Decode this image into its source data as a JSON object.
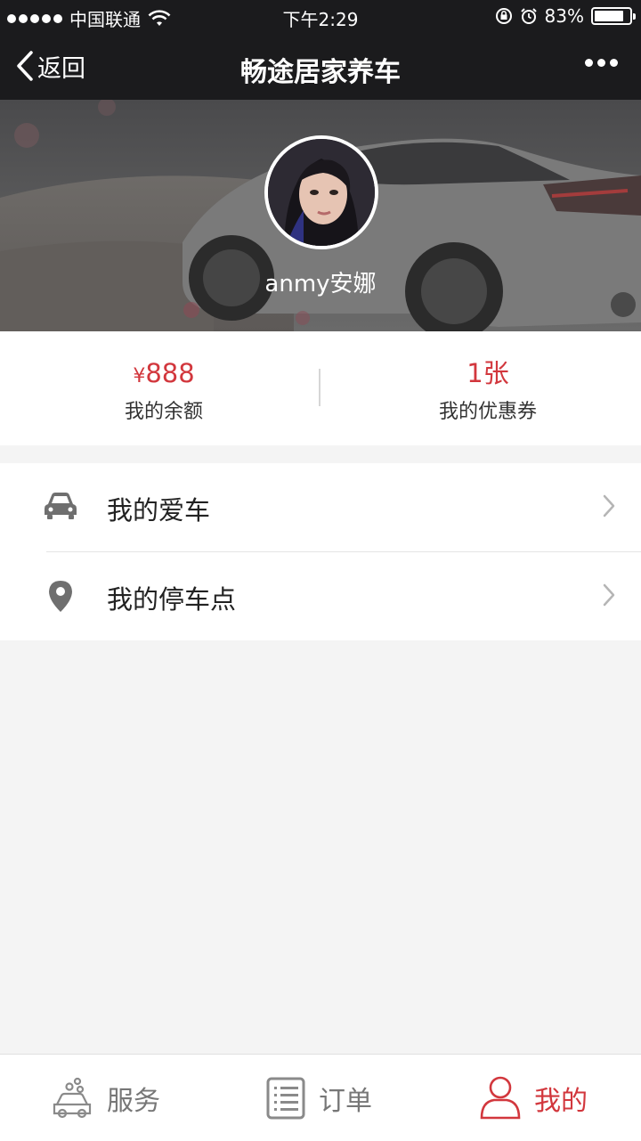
{
  "status_bar": {
    "carrier": "中国联通",
    "time": "下午2:29",
    "battery": "83%",
    "battery_level": 0.83
  },
  "nav": {
    "back_label": "返回",
    "title": "畅途居家养车"
  },
  "profile": {
    "username": "anmy安娜"
  },
  "stats": {
    "balance": {
      "currency": "¥",
      "value": "888",
      "label": "我的余额"
    },
    "coupons": {
      "value": "1张",
      "label": "我的优惠券"
    }
  },
  "menu": {
    "items": [
      {
        "label": "我的爱车",
        "icon": "car-icon"
      },
      {
        "label": "我的停车点",
        "icon": "location-pin-icon"
      }
    ]
  },
  "tabbar": {
    "tabs": [
      {
        "label": "服务",
        "icon": "car-wash-icon",
        "active": false
      },
      {
        "label": "订单",
        "icon": "order-list-icon",
        "active": false
      },
      {
        "label": "我的",
        "icon": "user-icon",
        "active": true
      }
    ]
  },
  "colors": {
    "accent": "#d2373d",
    "navbar": "#1b1b1d",
    "background": "#f4f4f4"
  }
}
